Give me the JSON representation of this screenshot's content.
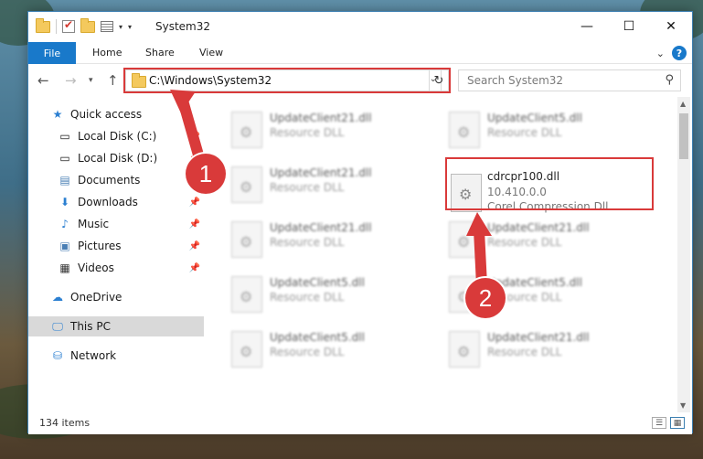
{
  "window": {
    "title": "System32",
    "minimize": "—",
    "maximize": "☐",
    "close": "✕"
  },
  "ribbon": {
    "tabs": [
      "File",
      "Home",
      "Share",
      "View"
    ]
  },
  "address_bar": {
    "path": "C:\\Windows\\System32",
    "search_placeholder": "Search System32"
  },
  "sidebar": {
    "items": [
      {
        "label": "Quick access",
        "icon": "star-icon",
        "pinned": false
      },
      {
        "label": "Local Disk (C:)",
        "icon": "drive-icon",
        "pinned": true
      },
      {
        "label": "Local Disk (D:)",
        "icon": "drive-icon",
        "pinned": true
      },
      {
        "label": "Documents",
        "icon": "documents-icon",
        "pinned": true
      },
      {
        "label": "Downloads",
        "icon": "download-icon",
        "pinned": true
      },
      {
        "label": "Music",
        "icon": "music-icon",
        "pinned": true
      },
      {
        "label": "Pictures",
        "icon": "pictures-icon",
        "pinned": true
      },
      {
        "label": "Videos",
        "icon": "videos-icon",
        "pinned": true
      },
      {
        "label": "OneDrive",
        "icon": "cloud-icon",
        "pinned": false
      },
      {
        "label": "This PC",
        "icon": "computer-icon",
        "pinned": false,
        "selected": true
      },
      {
        "label": "Network",
        "icon": "network-icon",
        "pinned": false
      }
    ]
  },
  "files": {
    "left_column": [
      {
        "name": "UpdateClient21.dll",
        "type": "Resource DLL"
      },
      {
        "name": "UpdateClient21.dll",
        "type": "Resource DLL"
      },
      {
        "name": "UpdateClient21.dll",
        "type": "Resource DLL"
      },
      {
        "name": "UpdateClient5.dll",
        "type": "Resource DLL"
      },
      {
        "name": "UpdateClient5.dll",
        "type": "Resource DLL"
      }
    ],
    "right_column": [
      {
        "name": "UpdateClient5.dll",
        "type": "Resource DLL"
      },
      {
        "name": "UpdateClient21.dll",
        "type": "Resource DLL"
      },
      {
        "name": "UpdateClient5.dll",
        "type": "Resource DLL"
      },
      {
        "name": "UpdateClient21.dll",
        "type": "Resource DLL"
      }
    ],
    "highlighted": {
      "name": "cdrcpr100.dll",
      "version": "10.410.0.0",
      "description": "Corel Compression Dll"
    }
  },
  "status": {
    "item_count": "134 items"
  },
  "annotations": {
    "marker_1": "1",
    "marker_2": "2",
    "color": "#d93a3a"
  }
}
